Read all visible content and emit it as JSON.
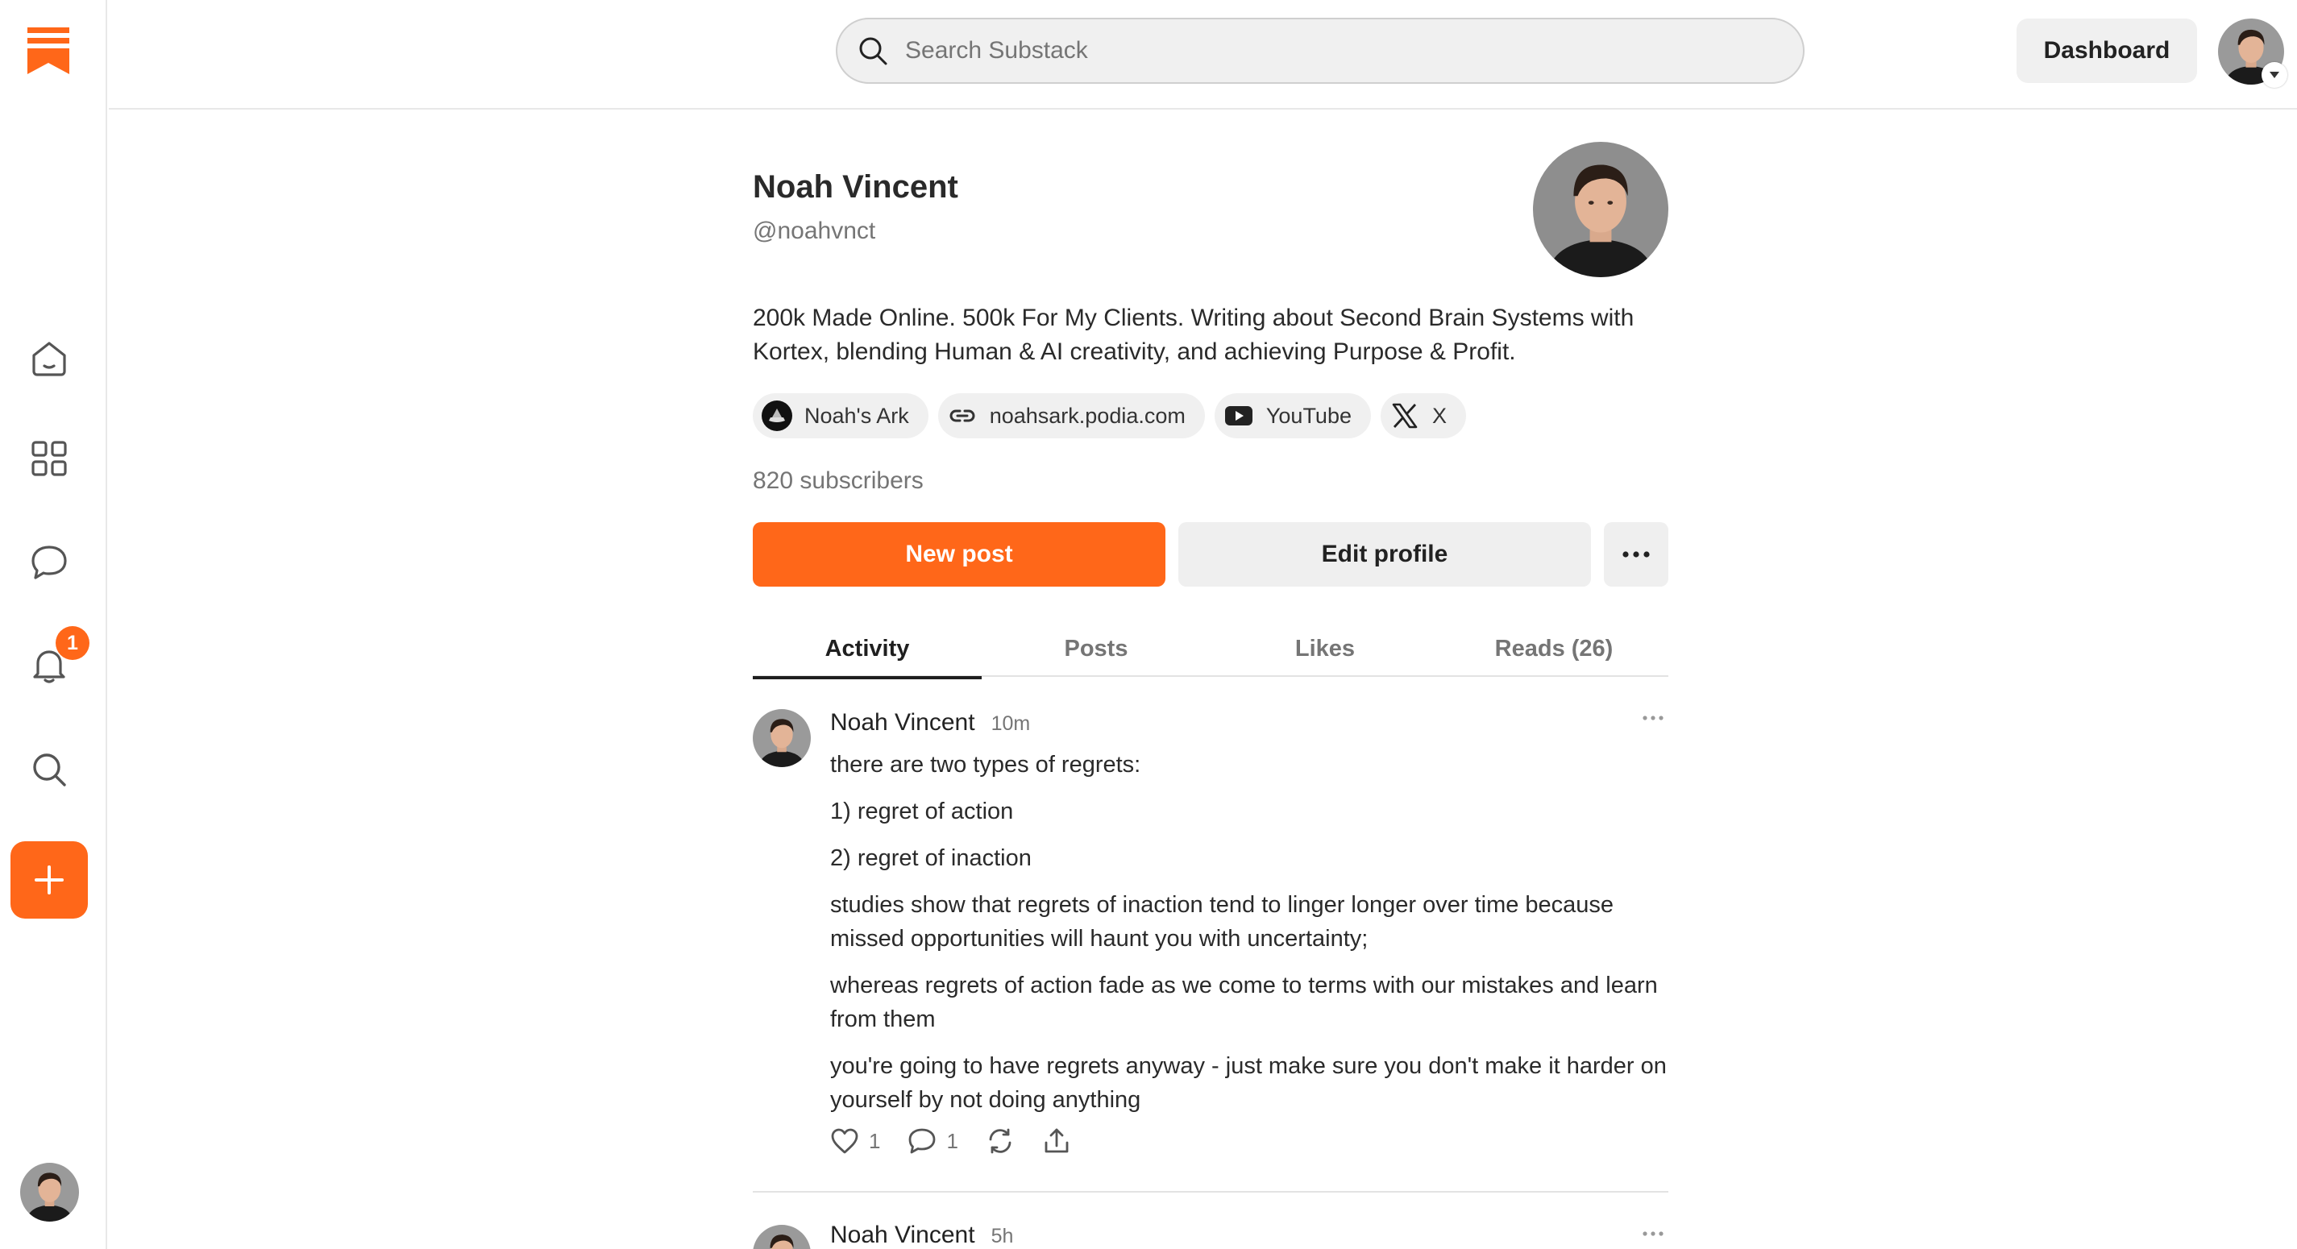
{
  "app": {
    "brand_color": "#ff6719",
    "logo": "substack-bookmark-logo"
  },
  "sidebar": {
    "items": [
      {
        "name": "home",
        "icon": "home-icon"
      },
      {
        "name": "explore",
        "icon": "grid-icon"
      },
      {
        "name": "chat",
        "icon": "chat-bubble-icon"
      },
      {
        "name": "activity",
        "icon": "bell-icon",
        "badge": "1"
      },
      {
        "name": "search",
        "icon": "search-icon"
      },
      {
        "name": "create",
        "icon": "plus-icon"
      }
    ]
  },
  "topbar": {
    "search_placeholder": "Search Substack",
    "dashboard_label": "Dashboard"
  },
  "profile": {
    "name": "Noah Vincent",
    "handle": "@noahvnct",
    "bio": "200k Made Online. 500k For My Clients. Writing about Second Brain Systems with Kortex, blending Human & AI creativity, and achieving Purpose & Profit.",
    "links": [
      {
        "label": "Noah's Ark",
        "icon": "publication-logo-icon"
      },
      {
        "label": "noahsark.podia.com",
        "icon": "link-icon"
      },
      {
        "label": "YouTube",
        "icon": "youtube-icon"
      },
      {
        "label": "X",
        "icon": "x-logo-icon"
      }
    ],
    "subscribers": "820 subscribers",
    "new_post_label": "New post",
    "edit_profile_label": "Edit profile"
  },
  "tabs": [
    {
      "label": "Activity",
      "active": true
    },
    {
      "label": "Posts",
      "active": false
    },
    {
      "label": "Likes",
      "active": false
    },
    {
      "label": "Reads (26)",
      "active": false
    }
  ],
  "posts": [
    {
      "author": "Noah Vincent",
      "time": "10m",
      "paragraphs": [
        "there are two types of regrets:",
        "1) regret of action",
        "2) regret of inaction",
        "studies show that regrets of inaction tend to linger longer over time because missed opportunities will haunt you with uncertainty;",
        "whereas regrets of action fade as we come to terms with our mistakes and learn from them",
        "you're going to have regrets anyway - just make sure you don't make it harder on yourself by not doing anything"
      ],
      "likes": "1",
      "comments": "1"
    },
    {
      "author": "Noah Vincent",
      "time": "5h"
    }
  ]
}
